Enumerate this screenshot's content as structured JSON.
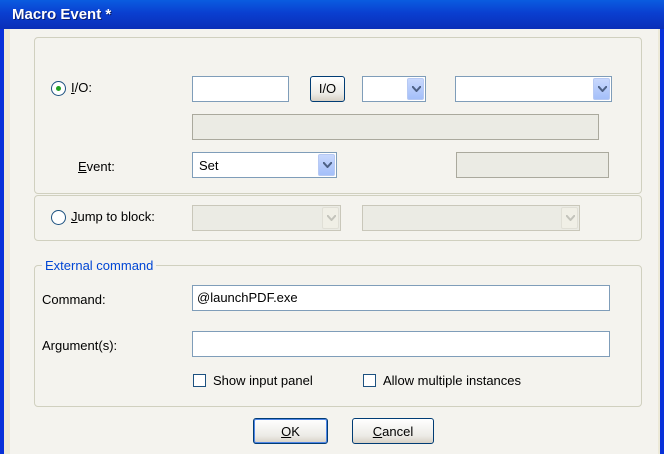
{
  "window": {
    "title": "Macro Event *"
  },
  "io": {
    "radio_label_first": "I",
    "radio_label_rest": "/O:",
    "selected": true,
    "input_value": "",
    "io_button_label": "I/O",
    "small_combo_value": "",
    "large_combo_value": "",
    "description_value": "",
    "event_label_first": "E",
    "event_label_rest": "vent:",
    "event_value": "Set",
    "event_extra_value": ""
  },
  "jump": {
    "radio_label_first": "J",
    "radio_label_rest": "ump to block:",
    "selected": false,
    "combo1_value": "",
    "combo2_value": ""
  },
  "external": {
    "legend": "External command",
    "command_label": "Command:",
    "command_value": "@launchPDF.exe",
    "arguments_label": "Argument(s):",
    "arguments_value": "",
    "show_input_panel_label": "Show input panel",
    "show_input_panel_checked": false,
    "allow_multiple_label": "Allow multiple instances",
    "allow_multiple_checked": false
  },
  "buttons": {
    "ok_first": "O",
    "ok_rest": "K",
    "cancel_first": "C",
    "cancel_rest": "ancel"
  },
  "colors": {
    "titlebar": "#0a4fd6",
    "legend_text": "#0046d5",
    "radio_dot": "#21a121"
  }
}
